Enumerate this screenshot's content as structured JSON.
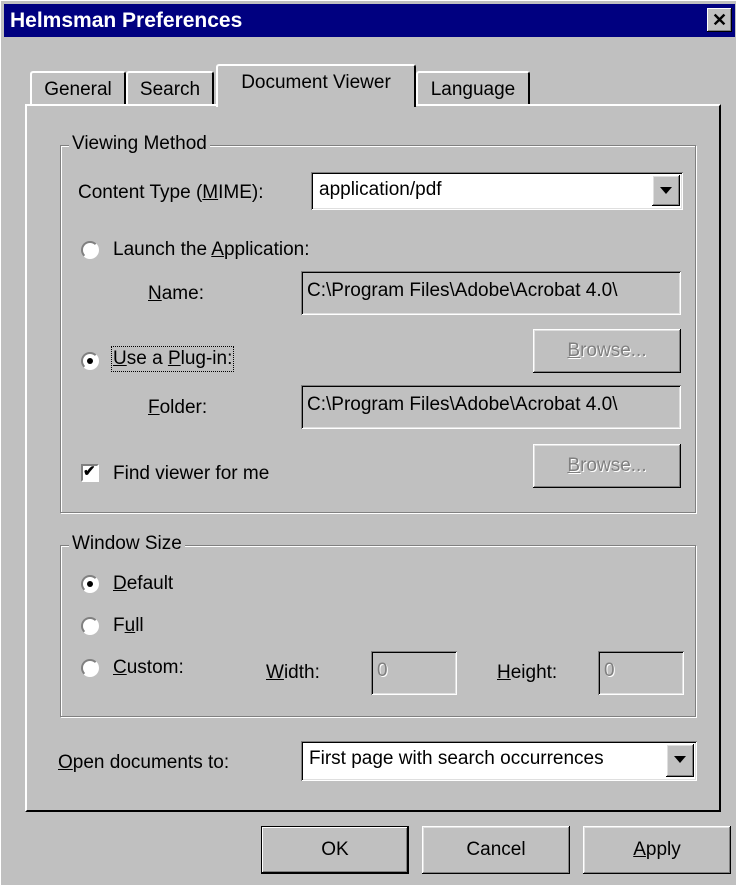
{
  "window": {
    "title": "Helmsman Preferences",
    "close_glyph": "✕"
  },
  "tabs": [
    {
      "label": "General"
    },
    {
      "label": "Search"
    },
    {
      "label": "Document Viewer",
      "selected": true
    },
    {
      "label": "Language"
    }
  ],
  "viewing_method": {
    "legend": "Viewing Method",
    "content_type_label": "Content Type (MIME):",
    "content_type_value": "application/pdf",
    "launch_label": "Launch the Application:",
    "launch_selected": false,
    "name_label": "Name:",
    "name_value": "C:\\Program Files\\Adobe\\Acrobat 4.0\\",
    "browse1_label": "Browse...",
    "plugin_label": "Use a Plug-in:",
    "plugin_selected": true,
    "folder_label": "Folder:",
    "folder_value": "C:\\Program Files\\Adobe\\Acrobat 4.0\\",
    "find_viewer_label": "Find viewer for me",
    "find_viewer_checked": true,
    "browse2_label": "Browse..."
  },
  "window_size": {
    "legend": "Window Size",
    "default_label": "Default",
    "full_label": "Full",
    "custom_label": "Custom:",
    "selected": "Default",
    "width_label": "Width:",
    "width_value": "0",
    "height_label": "Height:",
    "height_value": "0"
  },
  "open_docs": {
    "label": "Open documents to:",
    "value": "First page with search occurrences"
  },
  "buttons": {
    "ok": "OK",
    "cancel": "Cancel",
    "apply": "Apply"
  }
}
